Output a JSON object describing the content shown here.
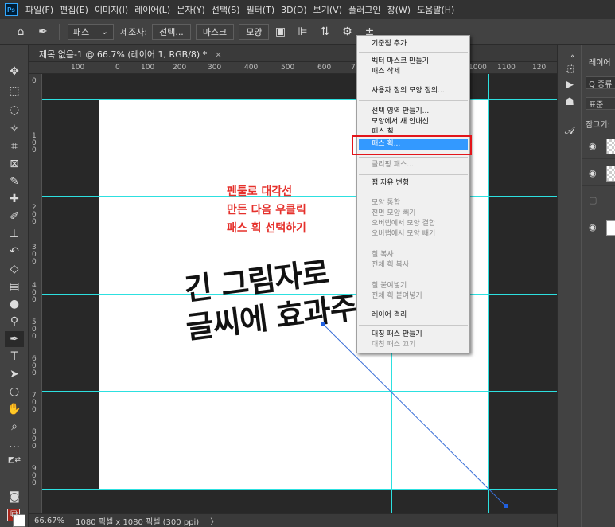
{
  "menubar": {
    "logo": "Ps",
    "items": [
      "파일(F)",
      "편집(E)",
      "이미지(I)",
      "레이어(L)",
      "문자(Y)",
      "선택(S)",
      "필터(T)",
      "3D(D)",
      "보기(V)",
      "플러그인",
      "창(W)",
      "도움말(H)"
    ]
  },
  "options": {
    "mode_value": "패스",
    "make_label": "제조사:",
    "selection_btn": "선택...",
    "mask_btn": "마스크",
    "shape_btn": "모양"
  },
  "document": {
    "tab_title": "제목 없음-1 @ 66.7% (레이어 1, RGB/8) *",
    "ruler_h_ticks": [
      "100",
      "0",
      "100",
      "200",
      "300",
      "400",
      "500",
      "600",
      "700",
      "1000",
      "1100",
      "120"
    ],
    "ruler_v_ticks": [
      "0",
      "1\n0\n0",
      "2\n0\n0",
      "3\n0\n0",
      "4\n0\n0",
      "5\n0\n0",
      "6\n0\n0",
      "7\n0\n0",
      "8\n0\n0",
      "9\n0\n0",
      "1\n0\n0\n0"
    ],
    "annotation_lines": [
      "펜툴로 대각선",
      "만든 다음 우클릭",
      "패스 획 선택하기"
    ],
    "big_text_lines": [
      "긴 그림자로",
      "글씨에 효과주"
    ]
  },
  "status": {
    "zoom": "66.67%",
    "doc_info": "1080 픽셀 x 1080 픽셀 (300 ppi)",
    "arrow": "〉"
  },
  "context_menu": {
    "items": [
      {
        "label": "기준점 추가",
        "disabled": false
      },
      {
        "label": "벡터 마스크 만들기",
        "disabled": false
      },
      {
        "label": "패스 삭제",
        "disabled": false
      },
      {
        "label": "사용자 정의 모양 정의...",
        "disabled": false
      },
      {
        "label": "선택 영역 만들기...",
        "disabled": false
      },
      {
        "label": "모양에서 새 안내선",
        "disabled": false
      },
      {
        "label": "패스 칠",
        "disabled": false
      },
      {
        "label": "패스 획...",
        "disabled": false,
        "selected": true
      },
      {
        "label": "클리핑 패스...",
        "disabled": true
      },
      {
        "label": "점 자유 변형",
        "disabled": false
      },
      {
        "label": "모양 통합",
        "disabled": true
      },
      {
        "label": "전면 모양 빼기",
        "disabled": true
      },
      {
        "label": "오버랩에서 모양 결합",
        "disabled": true
      },
      {
        "label": "오버랩에서 모양 빼기",
        "disabled": true
      },
      {
        "label": "칠 복사",
        "disabled": true
      },
      {
        "label": "전체 획 복사",
        "disabled": true
      },
      {
        "label": "칠 붙여넣기",
        "disabled": true
      },
      {
        "label": "전체 획 붙여넣기",
        "disabled": true
      },
      {
        "label": "레이어 격리",
        "disabled": false
      },
      {
        "label": "대칭 패스 만들기",
        "disabled": false
      },
      {
        "label": "대칭 패스 끄기",
        "disabled": true
      }
    ]
  },
  "layers_panel": {
    "tab": "레이어",
    "search": "Q 종류",
    "blend_mode": "표준",
    "lock_label": "잠그기:"
  },
  "colors": {
    "foreground": "#a8261c",
    "background": "#ffffff",
    "guide": "#2de0e0",
    "highlight": "#e3151a",
    "menu_selected": "#3399ff"
  }
}
